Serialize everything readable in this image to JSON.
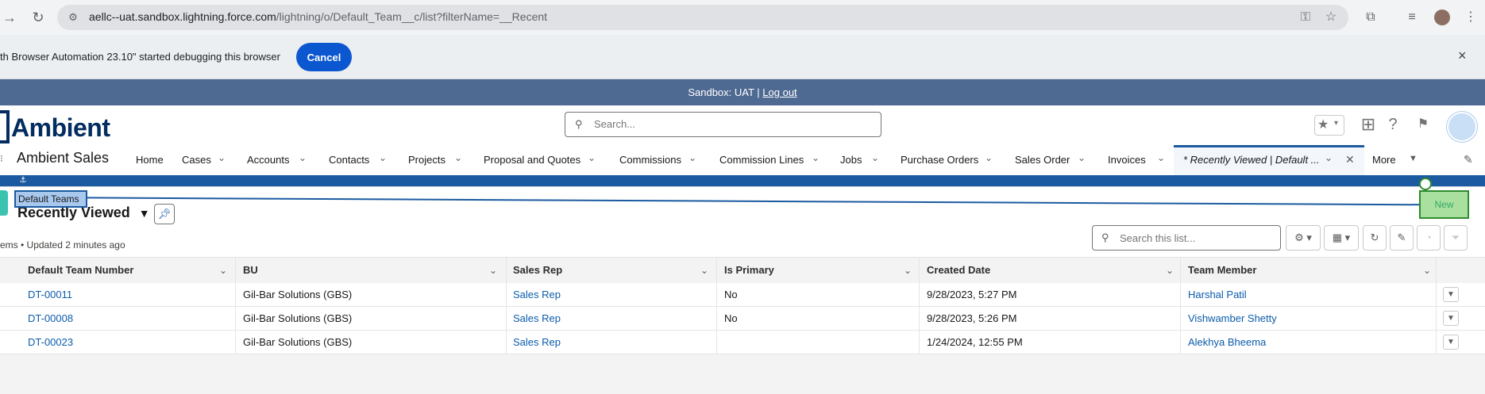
{
  "browser": {
    "url_main": "aellc--uat.sandbox.lightning.force.com",
    "url_path": "/lightning/o/Default_Team__c/list?filterName=__Recent"
  },
  "debug_bar": {
    "message": "th Browser Automation 23.10\" started debugging this browser",
    "cancel_label": "Cancel",
    "close_icon": "×"
  },
  "sandbox_banner": {
    "text": "Sandbox: UAT | ",
    "logout_label": "Log out"
  },
  "header": {
    "logo_text": "Ambient",
    "search_placeholder": "Search..."
  },
  "nav": {
    "app_name": "Ambient Sales",
    "items": [
      {
        "label": "Home"
      },
      {
        "label": "Cases"
      },
      {
        "label": "Accounts"
      },
      {
        "label": "Contacts"
      },
      {
        "label": "Projects"
      },
      {
        "label": "Proposal and Quotes"
      },
      {
        "label": "Commissions"
      },
      {
        "label": "Commission Lines"
      },
      {
        "label": "Jobs"
      },
      {
        "label": "Purchase Orders"
      },
      {
        "label": "Sales Order"
      },
      {
        "label": "Invoices"
      }
    ],
    "active_tab": "* Recently Viewed | Default ...",
    "more_label": "More"
  },
  "list_view": {
    "object_label": "Default Teams",
    "title": "Recently Viewed",
    "meta": "ems • Updated 2 minutes ago",
    "search_placeholder": "Search this list...",
    "new_label": "New"
  },
  "table": {
    "columns": [
      "Default Team Number",
      "BU",
      "Sales Rep",
      "Is Primary",
      "Created Date",
      "Team Member"
    ],
    "rows": [
      {
        "number": "DT-00011",
        "bu": "Gil-Bar Solutions (GBS)",
        "sales_rep": "Sales Rep",
        "is_primary": "No",
        "created": "9/28/2023, 5:27 PM",
        "member": "Harshal Patil"
      },
      {
        "number": "DT-00008",
        "bu": "Gil-Bar Solutions (GBS)",
        "sales_rep": "Sales Rep",
        "is_primary": "No",
        "created": "9/28/2023, 5:26 PM",
        "member": "Vishwamber Shetty"
      },
      {
        "number": "DT-00023",
        "bu": "Gil-Bar Solutions (GBS)",
        "sales_rep": "Sales Rep",
        "is_primary": "",
        "created": "1/24/2024, 12:55 PM",
        "member": "Alekhya Bheema"
      }
    ]
  }
}
